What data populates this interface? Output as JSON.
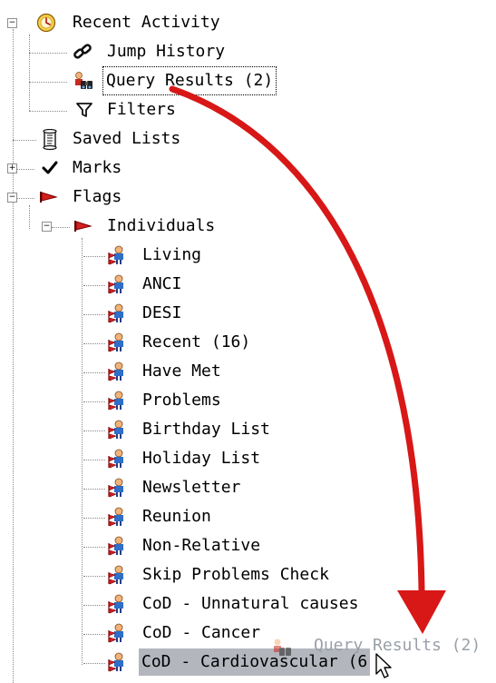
{
  "tree": {
    "recent_activity": "Recent Activity",
    "jump_history": "Jump History",
    "query_results": "Query Results (2)",
    "filters": "Filters",
    "saved_lists": "Saved Lists",
    "marks": "Marks",
    "flags": "Flags",
    "individuals": "Individuals",
    "flag_items": [
      "Living",
      "ANCI",
      "DESI",
      "Recent (16)",
      "Have Met",
      "Problems",
      "Birthday List",
      "Holiday List",
      "Newsletter",
      "Reunion",
      "Non-Relative",
      "Skip Problems Check",
      "CoD - Unnatural causes",
      "CoD - Cancer",
      "CoD - Cardiovascular (6"
    ]
  },
  "drag": {
    "ghost_label": "Query Results (2)"
  },
  "colors": {
    "arrow": "#d81717",
    "selection": "#b3b6bd",
    "flag": "#c81e1e",
    "ghost_text": "#9aa0a8"
  },
  "icons": {
    "recent_activity": "clock-icon",
    "jump_history": "chain-link-icon",
    "query_results": "binoculars-person-icon",
    "filters": "funnel-icon",
    "saved_lists": "scroll-list-icon",
    "marks": "checkmark-icon",
    "flags": "red-flag-icon",
    "individual_flag": "person-flag-icon"
  }
}
